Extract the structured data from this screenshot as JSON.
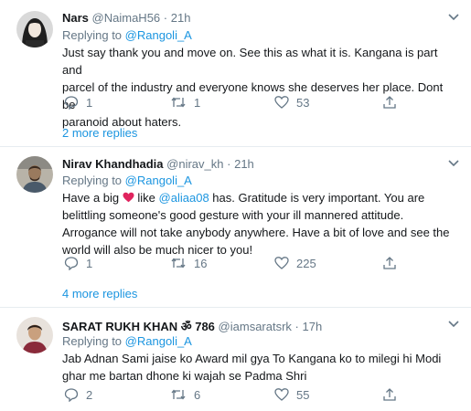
{
  "tweets": [
    {
      "name": "Nars",
      "handle": "@NaimaH56",
      "dot": "·",
      "time": "21h",
      "replying_prefix": "Replying to",
      "replying_to": "@Rangoli_A",
      "lines": [
        "Just say thank you and move on. See this as what it is. Kangana is part and",
        "parcel of the industry and everyone knows she deserves her place. Dont be",
        "paranoid about haters."
      ],
      "replies": "1",
      "retweets": "1",
      "likes": "53",
      "more_replies": "2 more replies"
    },
    {
      "name": "Nirav Khandhadia",
      "handle": "@nirav_kh",
      "dot": "·",
      "time": "21h",
      "replying_prefix": "Replying to",
      "replying_to": "@Rangoli_A",
      "line1_pre": "Have a big",
      "line1_mid": "like",
      "line1_mention": "@aliaa08",
      "line1_post": "has. Gratitude is very important. You are",
      "lines": [
        "belittling someone's good gesture with your ill mannered attitude.",
        "Arrogance will not take anybody anywhere. Have a bit of love and see the",
        "world will also be much nicer to you!"
      ],
      "replies": "1",
      "retweets": "16",
      "likes": "225",
      "more_replies": "4 more replies"
    },
    {
      "name": "SARAT RUKH KHAN ॐ 786",
      "handle": "@iamsaratsrk",
      "dot": "·",
      "time": "17h",
      "replying_prefix": "Replying to",
      "replying_to": "@Rangoli_A",
      "lines": [
        "Jab Adnan Sami jaise ko Award mil gya To Kangana ko to milegi hi Modi",
        "ghar me bartan dhone ki wajah se Padma Shri"
      ],
      "replies": "2",
      "retweets": "6",
      "likes": "55"
    }
  ],
  "colors": {
    "text": "#14171a",
    "muted": "#657786",
    "link": "#1b95e0",
    "heart": "#e0245e",
    "border": "#e6ecf0"
  }
}
